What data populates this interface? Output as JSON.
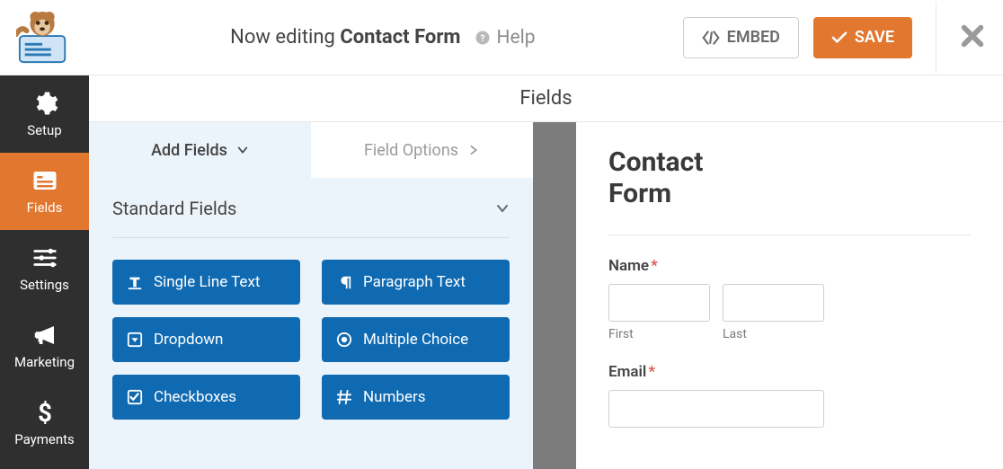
{
  "header": {
    "editing_prefix": "Now editing",
    "form_name": "Contact Form",
    "help_label": "Help",
    "embed_label": "EMBED",
    "save_label": "SAVE"
  },
  "nav": {
    "items": [
      {
        "id": "setup",
        "label": "Setup",
        "icon": "gear"
      },
      {
        "id": "fields",
        "label": "Fields",
        "icon": "form"
      },
      {
        "id": "settings",
        "label": "Settings",
        "icon": "sliders"
      },
      {
        "id": "marketing",
        "label": "Marketing",
        "icon": "bullhorn"
      },
      {
        "id": "payments",
        "label": "Payments",
        "icon": "dollar"
      }
    ],
    "active": "fields"
  },
  "section_title": "Fields",
  "panel": {
    "tabs": {
      "add_fields": "Add Fields",
      "field_options": "Field Options",
      "active": "add_fields"
    },
    "group_label": "Standard Fields",
    "field_buttons": [
      {
        "id": "single-line-text",
        "label": "Single Line Text",
        "icon": "text"
      },
      {
        "id": "paragraph-text",
        "label": "Paragraph Text",
        "icon": "paragraph"
      },
      {
        "id": "dropdown",
        "label": "Dropdown",
        "icon": "caret-square"
      },
      {
        "id": "multiple-choice",
        "label": "Multiple Choice",
        "icon": "dot-circle"
      },
      {
        "id": "checkboxes",
        "label": "Checkboxes",
        "icon": "check-square"
      },
      {
        "id": "numbers",
        "label": "Numbers",
        "icon": "hash"
      }
    ]
  },
  "preview": {
    "form_title": "Contact Form",
    "fields": {
      "name": {
        "label": "Name",
        "required": true,
        "first_sublabel": "First",
        "last_sublabel": "Last"
      },
      "email": {
        "label": "Email",
        "required": true
      }
    }
  },
  "colors": {
    "accent": "#e27730",
    "primary_button": "#0f6ab2",
    "panel_bg": "#ecf4fb",
    "nav_bg": "#2f2f2f"
  }
}
